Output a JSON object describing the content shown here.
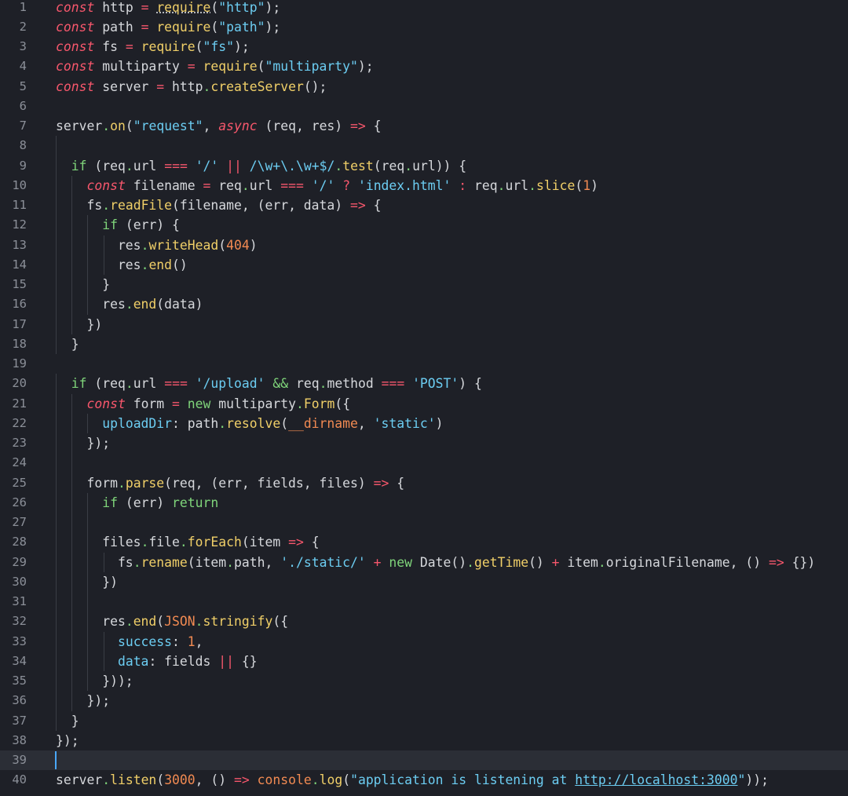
{
  "editor": {
    "language": "javascript",
    "current_line": 39,
    "colors": {
      "background": "#1e2027",
      "current_line": "#2b2e36",
      "line_number": "#8b8f98",
      "plain": "#d6d8dc",
      "storage": "#f7576c",
      "keyword": "#7fd47a",
      "string": "#6ccdf2",
      "function": "#f0cf68",
      "number": "#f18a52",
      "cursor": "#4aa8ff"
    },
    "lines": [
      {
        "n": "1",
        "indent": 0,
        "tokens": [
          [
            "storage",
            "const"
          ],
          [
            "plain",
            " http "
          ],
          [
            "operator",
            "="
          ],
          [
            "plain",
            " "
          ],
          [
            "func",
            "require"
          ],
          [
            "punct",
            "("
          ],
          [
            "string",
            "\"http\""
          ],
          [
            "punct",
            ");"
          ]
        ]
      },
      {
        "n": "2",
        "indent": 0,
        "tokens": [
          [
            "storage",
            "const"
          ],
          [
            "plain",
            " path "
          ],
          [
            "operator",
            "="
          ],
          [
            "plain",
            " "
          ],
          [
            "func",
            "require"
          ],
          [
            "punct",
            "("
          ],
          [
            "string",
            "\"path\""
          ],
          [
            "punct",
            ");"
          ]
        ]
      },
      {
        "n": "3",
        "indent": 0,
        "tokens": [
          [
            "storage",
            "const"
          ],
          [
            "plain",
            " fs "
          ],
          [
            "operator",
            "="
          ],
          [
            "plain",
            " "
          ],
          [
            "func",
            "require"
          ],
          [
            "punct",
            "("
          ],
          [
            "string",
            "\"fs\""
          ],
          [
            "punct",
            ");"
          ]
        ]
      },
      {
        "n": "4",
        "indent": 0,
        "tokens": [
          [
            "storage",
            "const"
          ],
          [
            "plain",
            " multiparty "
          ],
          [
            "operator",
            "="
          ],
          [
            "plain",
            " "
          ],
          [
            "func",
            "require"
          ],
          [
            "punct",
            "("
          ],
          [
            "string",
            "\"multiparty\""
          ],
          [
            "punct",
            ");"
          ]
        ]
      },
      {
        "n": "5",
        "indent": 0,
        "tokens": [
          [
            "storage",
            "const"
          ],
          [
            "plain",
            " server "
          ],
          [
            "operator",
            "="
          ],
          [
            "plain",
            " http"
          ],
          [
            "dot",
            "."
          ],
          [
            "func",
            "createServer"
          ],
          [
            "punct",
            "();"
          ]
        ]
      },
      {
        "n": "6",
        "indent": 0,
        "tokens": []
      },
      {
        "n": "7",
        "indent": 0,
        "tokens": [
          [
            "plain",
            "server"
          ],
          [
            "dot",
            "."
          ],
          [
            "func",
            "on"
          ],
          [
            "punct",
            "("
          ],
          [
            "string",
            "\"request\""
          ],
          [
            "punct",
            ", "
          ],
          [
            "storage",
            "async"
          ],
          [
            "plain",
            " (req, res) "
          ],
          [
            "operator",
            "=>"
          ],
          [
            "plain",
            " {"
          ]
        ]
      },
      {
        "n": "8",
        "indent": 1,
        "tokens": []
      },
      {
        "n": "9",
        "indent": 1,
        "tokens": [
          [
            "plain",
            "  "
          ],
          [
            "keyword",
            "if"
          ],
          [
            "plain",
            " (req"
          ],
          [
            "dot",
            "."
          ],
          [
            "property",
            "url"
          ],
          [
            "plain",
            " "
          ],
          [
            "operator",
            "==="
          ],
          [
            "plain",
            " "
          ],
          [
            "string",
            "'/'"
          ],
          [
            "plain",
            " "
          ],
          [
            "operator",
            "||"
          ],
          [
            "plain",
            " "
          ],
          [
            "regexp",
            "/\\w+\\.\\w+$/"
          ],
          [
            "dot",
            "."
          ],
          [
            "func",
            "test"
          ],
          [
            "plain",
            "(req"
          ],
          [
            "dot",
            "."
          ],
          [
            "property",
            "url"
          ],
          [
            "plain",
            ")) {"
          ]
        ]
      },
      {
        "n": "10",
        "indent": 2,
        "tokens": [
          [
            "plain",
            "    "
          ],
          [
            "storage",
            "const"
          ],
          [
            "plain",
            " filename "
          ],
          [
            "operator",
            "="
          ],
          [
            "plain",
            " req"
          ],
          [
            "dot",
            "."
          ],
          [
            "property",
            "url"
          ],
          [
            "plain",
            " "
          ],
          [
            "operator",
            "==="
          ],
          [
            "plain",
            " "
          ],
          [
            "string",
            "'/'"
          ],
          [
            "plain",
            " "
          ],
          [
            "operator",
            "?"
          ],
          [
            "plain",
            " "
          ],
          [
            "string",
            "'index.html'"
          ],
          [
            "plain",
            " "
          ],
          [
            "operator",
            ":"
          ],
          [
            "plain",
            " req"
          ],
          [
            "dot",
            "."
          ],
          [
            "property",
            "url"
          ],
          [
            "dot",
            "."
          ],
          [
            "func",
            "slice"
          ],
          [
            "plain",
            "("
          ],
          [
            "number",
            "1"
          ],
          [
            "plain",
            ")"
          ]
        ]
      },
      {
        "n": "11",
        "indent": 2,
        "tokens": [
          [
            "plain",
            "    fs"
          ],
          [
            "dot",
            "."
          ],
          [
            "func",
            "readFile"
          ],
          [
            "plain",
            "(filename, (err, data) "
          ],
          [
            "operator",
            "=>"
          ],
          [
            "plain",
            " {"
          ]
        ]
      },
      {
        "n": "12",
        "indent": 3,
        "tokens": [
          [
            "plain",
            "      "
          ],
          [
            "keyword",
            "if"
          ],
          [
            "plain",
            " (err) {"
          ]
        ]
      },
      {
        "n": "13",
        "indent": 4,
        "tokens": [
          [
            "plain",
            "        res"
          ],
          [
            "dot",
            "."
          ],
          [
            "func",
            "writeHead"
          ],
          [
            "plain",
            "("
          ],
          [
            "number",
            "404"
          ],
          [
            "plain",
            ")"
          ]
        ]
      },
      {
        "n": "14",
        "indent": 4,
        "tokens": [
          [
            "plain",
            "        res"
          ],
          [
            "dot",
            "."
          ],
          [
            "func",
            "end"
          ],
          [
            "plain",
            "()"
          ]
        ]
      },
      {
        "n": "15",
        "indent": 3,
        "tokens": [
          [
            "plain",
            "      }"
          ]
        ]
      },
      {
        "n": "16",
        "indent": 3,
        "tokens": [
          [
            "plain",
            "      res"
          ],
          [
            "dot",
            "."
          ],
          [
            "func",
            "end"
          ],
          [
            "plain",
            "(data)"
          ]
        ]
      },
      {
        "n": "17",
        "indent": 2,
        "tokens": [
          [
            "plain",
            "    })"
          ]
        ]
      },
      {
        "n": "18",
        "indent": 1,
        "tokens": [
          [
            "plain",
            "  }"
          ]
        ]
      },
      {
        "n": "19",
        "indent": 0,
        "tokens": []
      },
      {
        "n": "20",
        "indent": 1,
        "tokens": [
          [
            "plain",
            "  "
          ],
          [
            "keyword",
            "if"
          ],
          [
            "plain",
            " (req"
          ],
          [
            "dot",
            "."
          ],
          [
            "property",
            "url"
          ],
          [
            "plain",
            " "
          ],
          [
            "operator",
            "==="
          ],
          [
            "plain",
            " "
          ],
          [
            "string",
            "'/upload'"
          ],
          [
            "plain",
            " "
          ],
          [
            "keyword",
            "&&"
          ],
          [
            "plain",
            " req"
          ],
          [
            "dot",
            "."
          ],
          [
            "property",
            "method"
          ],
          [
            "plain",
            " "
          ],
          [
            "operator",
            "==="
          ],
          [
            "plain",
            " "
          ],
          [
            "string",
            "'POST'"
          ],
          [
            "plain",
            ") {"
          ]
        ]
      },
      {
        "n": "21",
        "indent": 2,
        "tokens": [
          [
            "plain",
            "    "
          ],
          [
            "storage",
            "const"
          ],
          [
            "plain",
            " form "
          ],
          [
            "operator",
            "="
          ],
          [
            "plain",
            " "
          ],
          [
            "keyword",
            "new"
          ],
          [
            "plain",
            " multiparty"
          ],
          [
            "dot",
            "."
          ],
          [
            "func",
            "Form"
          ],
          [
            "plain",
            "({"
          ]
        ]
      },
      {
        "n": "22",
        "indent": 3,
        "tokens": [
          [
            "plain",
            "      "
          ],
          [
            "key",
            "uploadDir"
          ],
          [
            "plain",
            ": path"
          ],
          [
            "dot",
            "."
          ],
          [
            "func",
            "resolve"
          ],
          [
            "plain",
            "("
          ],
          [
            "builtin",
            "__dirname"
          ],
          [
            "plain",
            ", "
          ],
          [
            "string",
            "'static'"
          ],
          [
            "plain",
            ")"
          ]
        ]
      },
      {
        "n": "23",
        "indent": 2,
        "tokens": [
          [
            "plain",
            "    });"
          ]
        ]
      },
      {
        "n": "24",
        "indent": 2,
        "tokens": []
      },
      {
        "n": "25",
        "indent": 2,
        "tokens": [
          [
            "plain",
            "    form"
          ],
          [
            "dot",
            "."
          ],
          [
            "func",
            "parse"
          ],
          [
            "plain",
            "(req, (err, fields, files) "
          ],
          [
            "operator",
            "=>"
          ],
          [
            "plain",
            " {"
          ]
        ]
      },
      {
        "n": "26",
        "indent": 3,
        "tokens": [
          [
            "plain",
            "      "
          ],
          [
            "keyword",
            "if"
          ],
          [
            "plain",
            " (err) "
          ],
          [
            "keyword",
            "return"
          ]
        ]
      },
      {
        "n": "27",
        "indent": 3,
        "tokens": []
      },
      {
        "n": "28",
        "indent": 3,
        "tokens": [
          [
            "plain",
            "      files"
          ],
          [
            "dot",
            "."
          ],
          [
            "property",
            "file"
          ],
          [
            "dot",
            "."
          ],
          [
            "func",
            "forEach"
          ],
          [
            "plain",
            "(item "
          ],
          [
            "operator",
            "=>"
          ],
          [
            "plain",
            " {"
          ]
        ]
      },
      {
        "n": "29",
        "indent": 4,
        "tokens": [
          [
            "plain",
            "        fs"
          ],
          [
            "dot",
            "."
          ],
          [
            "func",
            "rename"
          ],
          [
            "plain",
            "(item"
          ],
          [
            "dot",
            "."
          ],
          [
            "property",
            "path"
          ],
          [
            "plain",
            ", "
          ],
          [
            "string",
            "'./static/'"
          ],
          [
            "plain",
            " "
          ],
          [
            "operator",
            "+"
          ],
          [
            "plain",
            " "
          ],
          [
            "keyword",
            "new"
          ],
          [
            "plain",
            " Date()"
          ],
          [
            "dot",
            "."
          ],
          [
            "func",
            "getTime"
          ],
          [
            "plain",
            "() "
          ],
          [
            "operator",
            "+"
          ],
          [
            "plain",
            " item"
          ],
          [
            "dot",
            "."
          ],
          [
            "property",
            "originalFilename"
          ],
          [
            "plain",
            ", () "
          ],
          [
            "operator",
            "=>"
          ],
          [
            "plain",
            " {})"
          ]
        ]
      },
      {
        "n": "30",
        "indent": 3,
        "tokens": [
          [
            "plain",
            "      })"
          ]
        ]
      },
      {
        "n": "31",
        "indent": 3,
        "tokens": []
      },
      {
        "n": "32",
        "indent": 3,
        "tokens": [
          [
            "plain",
            "      res"
          ],
          [
            "dot",
            "."
          ],
          [
            "func",
            "end"
          ],
          [
            "plain",
            "("
          ],
          [
            "builtin",
            "JSON"
          ],
          [
            "dot",
            "."
          ],
          [
            "func",
            "stringify"
          ],
          [
            "plain",
            "({"
          ]
        ]
      },
      {
        "n": "33",
        "indent": 4,
        "tokens": [
          [
            "plain",
            "        "
          ],
          [
            "key",
            "success"
          ],
          [
            "plain",
            ": "
          ],
          [
            "number",
            "1"
          ],
          [
            "plain",
            ","
          ]
        ]
      },
      {
        "n": "34",
        "indent": 4,
        "tokens": [
          [
            "plain",
            "        "
          ],
          [
            "key",
            "data"
          ],
          [
            "plain",
            ": fields "
          ],
          [
            "operator",
            "||"
          ],
          [
            "plain",
            " {}"
          ]
        ]
      },
      {
        "n": "35",
        "indent": 3,
        "tokens": [
          [
            "plain",
            "      }));"
          ]
        ]
      },
      {
        "n": "36",
        "indent": 2,
        "tokens": [
          [
            "plain",
            "    });"
          ]
        ]
      },
      {
        "n": "37",
        "indent": 1,
        "tokens": [
          [
            "plain",
            "  }"
          ]
        ]
      },
      {
        "n": "38",
        "indent": 0,
        "tokens": [
          [
            "plain",
            "});"
          ]
        ]
      },
      {
        "n": "39",
        "indent": 0,
        "tokens": []
      },
      {
        "n": "40",
        "indent": 0,
        "tokens": [
          [
            "plain",
            "server"
          ],
          [
            "dot",
            "."
          ],
          [
            "func",
            "listen"
          ],
          [
            "plain",
            "("
          ],
          [
            "number",
            "3000"
          ],
          [
            "plain",
            ", () "
          ],
          [
            "operator",
            "=>"
          ],
          [
            "plain",
            " "
          ],
          [
            "builtin",
            "console"
          ],
          [
            "dot",
            "."
          ],
          [
            "func",
            "log"
          ],
          [
            "plain",
            "("
          ],
          [
            "string",
            "\"application is listening at "
          ],
          [
            "link",
            "http://localhost:3000"
          ],
          [
            "string",
            "\""
          ],
          [
            "plain",
            "));"
          ]
        ]
      }
    ]
  }
}
